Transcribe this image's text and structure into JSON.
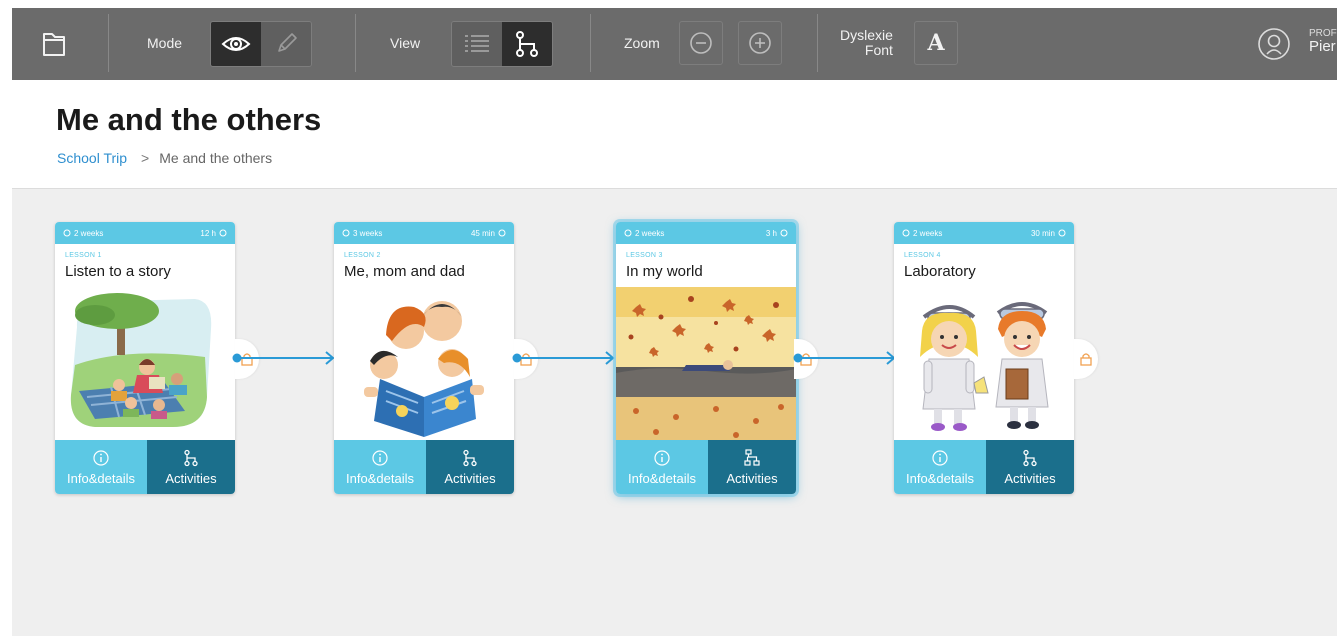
{
  "toolbar": {
    "mode_label": "Mode",
    "view_label": "View",
    "zoom_label": "Zoom",
    "dyslexie_label_line1": "Dyslexie",
    "dyslexie_label_line2": "Font",
    "font_button_glyph": "A",
    "profile_role": "PROF",
    "profile_name": "Pier",
    "mode_active": "view",
    "view_active": "map"
  },
  "page": {
    "title": "Me and the others",
    "breadcrumb": {
      "link": "School Trip",
      "separator": ">",
      "current": "Me and the others"
    }
  },
  "lessons": [
    {
      "duration_weeks": "2 weeks",
      "time": "12 h",
      "lesson_label": "LESSON 1",
      "title": "Listen to a story",
      "info_label": "Info&details",
      "activities_label": "Activities",
      "locked": true,
      "selected": false
    },
    {
      "duration_weeks": "3 weeks",
      "time": "45 min",
      "lesson_label": "LESSON 2",
      "title": "Me, mom and dad",
      "info_label": "Info&details",
      "activities_label": "Activities",
      "locked": true,
      "selected": false
    },
    {
      "duration_weeks": "2 weeks",
      "time": "3 h",
      "lesson_label": "LESSON 3",
      "title": "In my world",
      "info_label": "Info&details",
      "activities_label": "Activities",
      "locked": true,
      "selected": true
    },
    {
      "duration_weeks": "2 weeks",
      "time": "30 min",
      "lesson_label": "LESSON 4",
      "title": "Laboratory",
      "info_label": "Info&details",
      "activities_label": "Activities",
      "locked": true,
      "selected": false
    }
  ],
  "colors": {
    "toolbar_bg": "#6b6b6b",
    "card_accent": "#5cc8e4",
    "card_dark": "#1b6f8c",
    "connector": "#2a9ad6",
    "lock": "#f0a050",
    "link": "#2f8fcf"
  },
  "icons": [
    "folder-icon",
    "eye-icon",
    "pencil-icon",
    "list-icon",
    "map-icon",
    "zoom-out-icon",
    "zoom-in-icon",
    "avatar-icon",
    "info-icon",
    "activities-icon",
    "lock-icon",
    "clock-icon"
  ]
}
